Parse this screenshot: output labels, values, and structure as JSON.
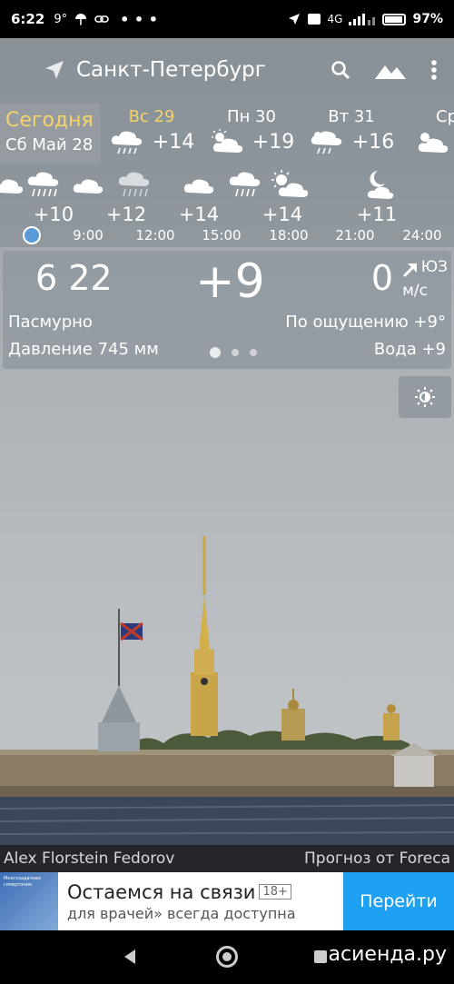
{
  "status_bar": {
    "time": "6:22",
    "temp": "9°",
    "network": "4G",
    "battery": "97%"
  },
  "app_bar": {
    "city": "Санкт-Петербург"
  },
  "days": {
    "today_label": "Сегодня",
    "today_date": "Сб Май 28",
    "items": [
      {
        "name": "Вс 29",
        "temp": "+14",
        "icon": "rain-cloud-icon"
      },
      {
        "name": "Пн 30",
        "temp": "+19",
        "icon": "partly-cloudy-icon"
      },
      {
        "name": "Вт 31",
        "temp": "+16",
        "icon": "rain-sun-cloud-icon"
      },
      {
        "name": "Ср",
        "temp": "",
        "icon": "partly-cloudy-icon"
      }
    ]
  },
  "hourly": {
    "temps": [
      "+10",
      "+12",
      "+14",
      "+14",
      "+11"
    ],
    "times": [
      "9:00",
      "12:00",
      "15:00",
      "18:00",
      "21:00",
      "24:00"
    ]
  },
  "current": {
    "time": "6 22",
    "temp": "+9",
    "wind_speed": "0",
    "wind_dir": "ЮЗ",
    "wind_unit": "м/с",
    "condition": "Пасмурно",
    "feels_like": "По ощущению +9°",
    "pressure": "Давление 745 мм",
    "water": "Вода +9",
    "page_indicator": {
      "count": 3,
      "active": 0
    }
  },
  "credits": {
    "photo_author": "Alex Florstein Fedorov",
    "forecast_source": "Прогноз от Foreca"
  },
  "ad": {
    "thumb_text": "Многозадачная гипертония",
    "title": "Остаемся на связи",
    "age": "18+",
    "subtitle": "для врачей» всегда доступна",
    "button": "Перейти"
  },
  "watermark": "асиенда.ру",
  "colors": {
    "today_accent": "#f5d36a",
    "ad_button": "#1ea1f2",
    "panel": "#8a929a"
  }
}
